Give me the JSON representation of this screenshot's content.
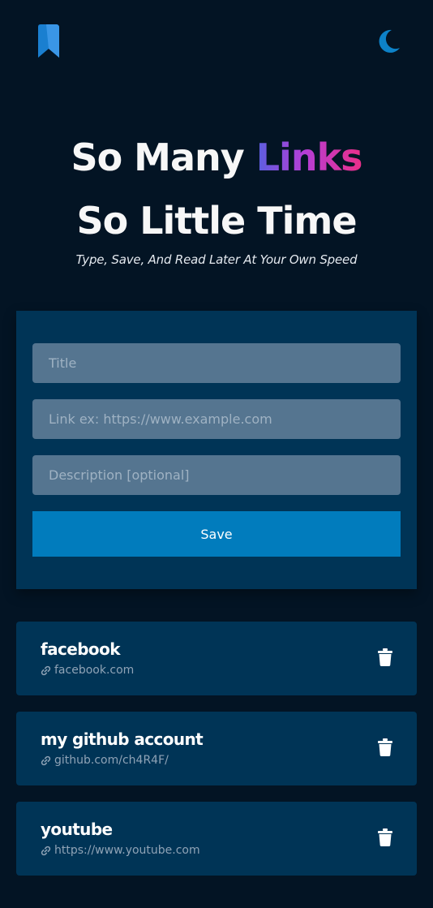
{
  "header": {
    "logo_icon": "bookmark-icon",
    "theme_icon": "moon-icon",
    "accent_color": "#117ec7"
  },
  "hero": {
    "line1_prefix": "So Many",
    "line1_highlight": "Links",
    "line2": "So Little Time",
    "tagline": "Type, Save, And Read Later At Your Own Speed"
  },
  "form": {
    "title_placeholder": "Title",
    "title_value": "",
    "link_placeholder": "Link ex: https://www.example.com",
    "link_value": "",
    "description_placeholder": "Description [optional]",
    "description_value": "",
    "save_label": "Save"
  },
  "links": [
    {
      "title": "facebook",
      "url": "facebook.com"
    },
    {
      "title": "my github account",
      "url": "github.com/ch4R4F/"
    },
    {
      "title": "youtube",
      "url": "https://www.youtube.com"
    }
  ],
  "icons": {
    "link": "link-icon",
    "delete": "trash-icon"
  }
}
